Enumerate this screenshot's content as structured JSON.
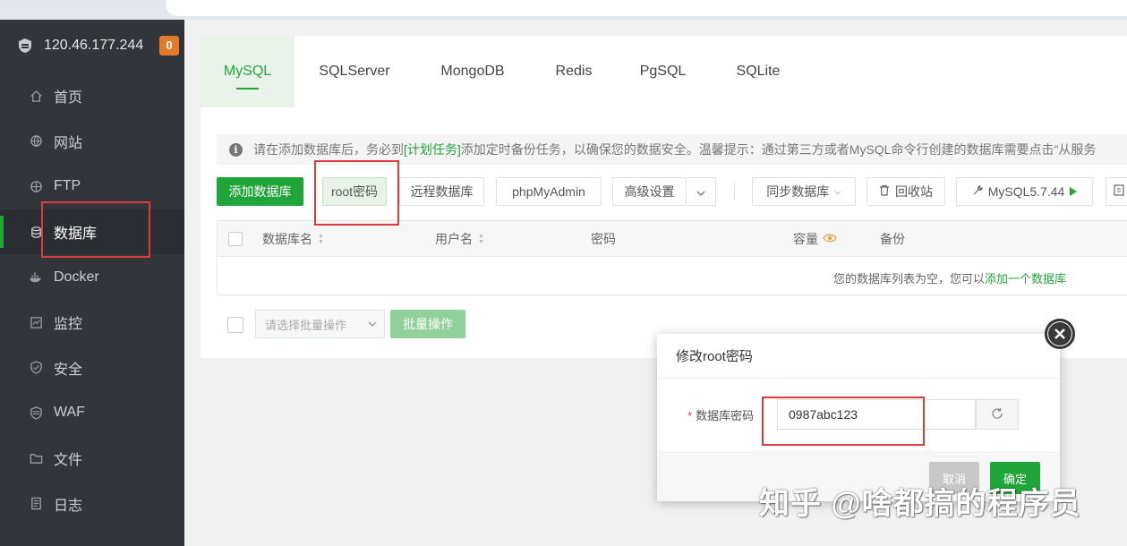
{
  "server": {
    "ip": "120.46.177.244",
    "badge": "0"
  },
  "sidebar": {
    "items": [
      {
        "label": "首页",
        "icon": "home-icon"
      },
      {
        "label": "网站",
        "icon": "globe-icon"
      },
      {
        "label": "FTP",
        "icon": "ftp-icon"
      },
      {
        "label": "数据库",
        "icon": "database-icon",
        "active": true
      },
      {
        "label": "Docker",
        "icon": "docker-icon"
      },
      {
        "label": "监控",
        "icon": "monitor-icon"
      },
      {
        "label": "安全",
        "icon": "shield-icon"
      },
      {
        "label": "WAF",
        "icon": "waf-icon"
      },
      {
        "label": "文件",
        "icon": "folder-icon"
      },
      {
        "label": "日志",
        "icon": "log-icon"
      }
    ]
  },
  "tabs": [
    "MySQL",
    "SQLServer",
    "MongoDB",
    "Redis",
    "PgSQL",
    "SQLite"
  ],
  "notice": {
    "prefix": "请在添加数据库后，务必到",
    "link": "[计划任务]",
    "suffix": "添加定时备份任务，以确保您的数据安全。温馨提示：通过第三方或者MySQL命令行创建的数据库需要点击\"从服务"
  },
  "toolbar": {
    "add_db": "添加数据库",
    "root_password": "root密码",
    "remote_db": "远程数据库",
    "phpmyadmin": "phpMyAdmin",
    "advanced": "高级设置",
    "sync_db": "同步数据库",
    "recycle": "回收站",
    "mysql_version": "MySQL5.7.44"
  },
  "table": {
    "headers": {
      "name": "数据库名",
      "user": "用户名",
      "password": "密码",
      "capacity": "容量",
      "backup": "备份"
    },
    "empty_prefix": "您的数据库列表为空，您可以",
    "empty_link": "添加一个数据库"
  },
  "batch": {
    "placeholder": "请选择批量操作",
    "button": "批量操作"
  },
  "modal": {
    "title": "修改root密码",
    "field_label": "数据库密码",
    "field_value": "0987abc123",
    "cancel": "取消",
    "confirm": "确定"
  },
  "watermark": "知乎 @啥都搞的程序员",
  "colors": {
    "accent": "#20a53a",
    "sidebar": "#32363b",
    "highlight": "#e03a3a"
  }
}
